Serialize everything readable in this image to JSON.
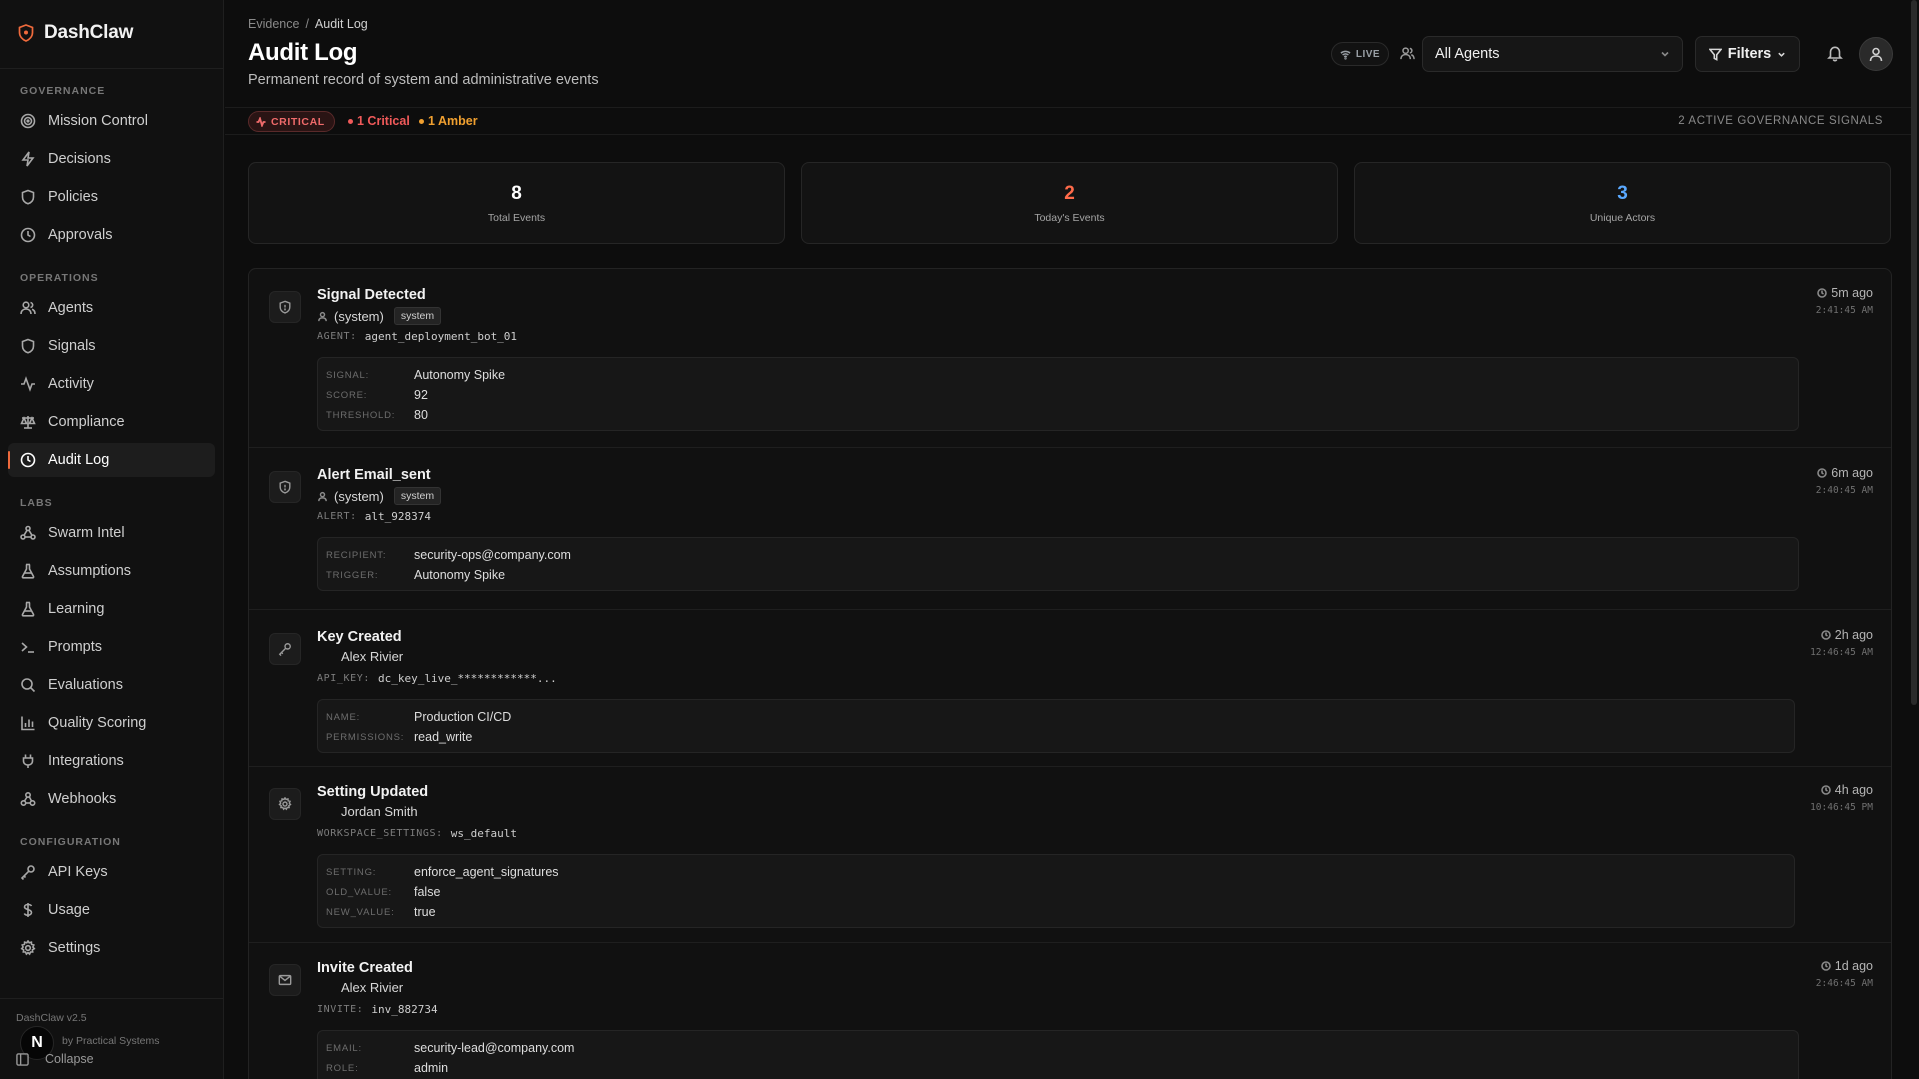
{
  "sidebar": {
    "brand": "DashClaw",
    "sections": [
      {
        "label": "GOVERNANCE",
        "items": [
          {
            "label": "Mission Control",
            "icon": "target-icon"
          },
          {
            "label": "Decisions",
            "icon": "bolt-icon"
          },
          {
            "label": "Policies",
            "icon": "shield-icon"
          },
          {
            "label": "Approvals",
            "icon": "clock-icon"
          }
        ]
      },
      {
        "label": "OPERATIONS",
        "items": [
          {
            "label": "Agents",
            "icon": "users-icon"
          },
          {
            "label": "Signals",
            "icon": "shield-icon"
          },
          {
            "label": "Activity",
            "icon": "activity-icon"
          },
          {
            "label": "Compliance",
            "icon": "scale-icon"
          },
          {
            "label": "Audit Log",
            "icon": "clock-icon",
            "active": true
          }
        ]
      },
      {
        "label": "LABS",
        "items": [
          {
            "label": "Swarm Intel",
            "icon": "network-icon"
          },
          {
            "label": "Assumptions",
            "icon": "flask-icon"
          },
          {
            "label": "Learning",
            "icon": "flask-icon"
          },
          {
            "label": "Prompts",
            "icon": "terminal-icon"
          },
          {
            "label": "Evaluations",
            "icon": "search-icon"
          },
          {
            "label": "Quality Scoring",
            "icon": "bar-chart-icon"
          },
          {
            "label": "Integrations",
            "icon": "plug-icon"
          },
          {
            "label": "Webhooks",
            "icon": "webhook-icon"
          }
        ]
      },
      {
        "label": "CONFIGURATION",
        "items": [
          {
            "label": "API Keys",
            "icon": "key-icon"
          },
          {
            "label": "Usage",
            "icon": "dollar-icon"
          },
          {
            "label": "Settings",
            "icon": "gear-icon"
          }
        ]
      }
    ],
    "version": "DashClaw v2.5",
    "credit": "by Practical Systems",
    "collapse_label": "Collapse",
    "n_badge": "N"
  },
  "header": {
    "breadcrumb": [
      "Evidence",
      "/",
      "Audit Log"
    ],
    "title": "Audit Log",
    "subtitle": "Permanent record of system and administrative events",
    "live_label": "LIVE",
    "agent_select": "All Agents",
    "filters_label": "Filters"
  },
  "signals": {
    "critical_label": "CRITICAL",
    "critical_count": "1 Critical",
    "amber_count": "1 Amber",
    "summary": "2 ACTIVE GOVERNANCE SIGNALS",
    "colors": {
      "critical": "#f05a5a",
      "amber": "#f0a030"
    }
  },
  "stats": [
    {
      "value": "8",
      "label": "Total Events",
      "color": "#ffffff"
    },
    {
      "value": "2",
      "label": "Today's Events",
      "color": "#ff6b4a"
    },
    {
      "value": "3",
      "label": "Unique Actors",
      "color": "#5aa9ff"
    }
  ],
  "events": [
    {
      "title": "Signal Detected",
      "icon": "shield-icon",
      "actor": "(system)",
      "tag": "system",
      "ref_key": "AGENT:",
      "ref_val": "agent_deployment_bot_01",
      "details": [
        [
          "SIGNAL:",
          "Autonomy Spike"
        ],
        [
          "SCORE:",
          "92"
        ],
        [
          "THRESHOLD:",
          "80"
        ]
      ],
      "ago": "5m ago",
      "clock": "2:41:45 AM"
    },
    {
      "title": "Alert Email_sent",
      "icon": "shield-icon",
      "actor": "(system)",
      "tag": "system",
      "ref_key": "ALERT:",
      "ref_val": "alt_928374",
      "details": [
        [
          "RECIPIENT:",
          "security-ops@company.com"
        ],
        [
          "TRIGGER:",
          "Autonomy Spike"
        ]
      ],
      "ago": "6m ago",
      "clock": "2:40:45 AM"
    },
    {
      "title": "Key Created",
      "icon": "key-icon",
      "actor": "Alex Rivier",
      "tag": "",
      "ref_key": "API_KEY:",
      "ref_val": "dc_key_live_************...",
      "details": [
        [
          "NAME:",
          "Production CI/CD"
        ],
        [
          "PERMISSIONS:",
          "read_write"
        ]
      ],
      "ago": "2h ago",
      "clock": "12:46:45 AM"
    },
    {
      "title": "Setting Updated",
      "icon": "gear-icon",
      "actor": "Jordan Smith",
      "tag": "",
      "ref_key": "WORKSPACE_SETTINGS:",
      "ref_val": "ws_default",
      "details": [
        [
          "SETTING:",
          "enforce_agent_signatures"
        ],
        [
          "OLD_VALUE:",
          "false"
        ],
        [
          "NEW_VALUE:",
          "true"
        ]
      ],
      "ago": "4h ago",
      "clock": "10:46:45 PM"
    },
    {
      "title": "Invite Created",
      "icon": "mail-icon",
      "actor": "Alex Rivier",
      "tag": "",
      "ref_key": "INVITE:",
      "ref_val": "inv_882734",
      "details": [
        [
          "EMAIL:",
          "security-lead@company.com"
        ],
        [
          "ROLE:",
          "admin"
        ]
      ],
      "ago": "1d ago",
      "clock": "2:46:45 AM"
    }
  ]
}
